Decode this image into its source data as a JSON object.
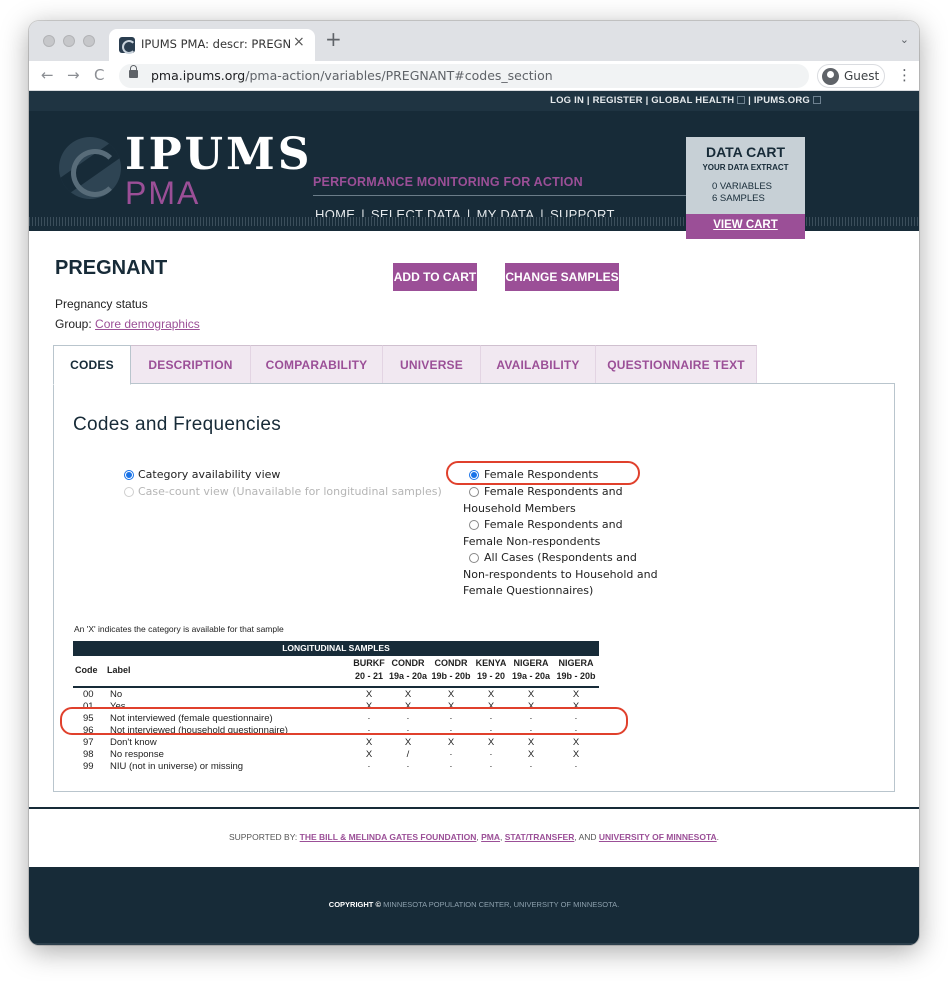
{
  "browser": {
    "tab_title": "IPUMS PMA: descr: PREGNANT",
    "tab_close": "×",
    "new_tab": "+",
    "tab_menu": "⌄",
    "url_host": "pma.ipums.org",
    "url_path": "/pma-action/variables/PREGNANT#codes_section",
    "guest_label": "Guest",
    "back": "←",
    "forward": "→",
    "reload": "C",
    "menu": "⋮"
  },
  "site": {
    "top_links": [
      "LOG IN",
      "REGISTER",
      "GLOBAL HEALTH",
      "IPUMS.ORG"
    ],
    "logo_main": "IPUMS",
    "logo_sub": "PMA",
    "tagline": "PERFORMANCE MONITORING FOR ACTION",
    "nav": [
      "HOME",
      "SELECT DATA",
      "MY DATA",
      "SUPPORT"
    ]
  },
  "cart": {
    "title": "DATA CART",
    "subtitle": "YOUR DATA EXTRACT",
    "variables": "0  VARIABLES",
    "samples": "6  SAMPLES",
    "view_cart": "VIEW CART"
  },
  "variable": {
    "name": "PREGNANT",
    "add_to_cart": "ADD TO CART",
    "change_samples": "CHANGE SAMPLES",
    "description": "Pregnancy status",
    "group_label": "Group: ",
    "group_link": "Core demographics"
  },
  "tabs": [
    "CODES",
    "DESCRIPTION",
    "COMPARABILITY",
    "UNIVERSE",
    "AVAILABILITY",
    "QUESTIONNAIRE TEXT"
  ],
  "codes": {
    "title": "Codes and Frequencies",
    "view_options": [
      {
        "label": "Category availability view",
        "checked": true,
        "disabled": false
      },
      {
        "label": "Case-count view (Unavailable for longitudinal samples)",
        "checked": false,
        "disabled": true
      }
    ],
    "universe_options": [
      {
        "label": "Female Respondents",
        "checked": true
      },
      {
        "label": "Female Respondents and Household Members",
        "checked": false
      },
      {
        "label": "Female Respondents and Female Non-respondents",
        "checked": false
      },
      {
        "label": "All Cases (Respondents and Non-respondents to Household and Female Questionnaires)",
        "checked": false
      }
    ],
    "note": "An 'X' indicates the category is available for that sample",
    "table_header": "LONGITUDINAL SAMPLES",
    "col_code": "Code",
    "col_label": "Label",
    "samples": [
      {
        "top": "BURKF",
        "bottom": "20 - 21"
      },
      {
        "top": "CONDR",
        "bottom": "19a - 20a"
      },
      {
        "top": "CONDR",
        "bottom": "19b - 20b"
      },
      {
        "top": "KENYA",
        "bottom": "19 - 20"
      },
      {
        "top": "NIGERA",
        "bottom": "19a - 20a"
      },
      {
        "top": "NIGERA",
        "bottom": "19b - 20b"
      }
    ],
    "rows": [
      {
        "code": "00",
        "label": "No",
        "vals": [
          "X",
          "X",
          "X",
          "X",
          "X",
          "X"
        ]
      },
      {
        "code": "01",
        "label": "Yes",
        "vals": [
          "X",
          "X",
          "X",
          "X",
          "X",
          "X"
        ]
      },
      {
        "code": "95",
        "label": "Not interviewed (female questionnaire)",
        "vals": [
          "·",
          "·",
          "·",
          "·",
          "·",
          "·"
        ]
      },
      {
        "code": "96",
        "label": "Not interviewed (household questionnaire)",
        "vals": [
          "·",
          "·",
          "·",
          "·",
          "·",
          "·"
        ]
      },
      {
        "code": "97",
        "label": "Don't know",
        "vals": [
          "X",
          "X",
          "X",
          "X",
          "X",
          "X"
        ]
      },
      {
        "code": "98",
        "label": "No response",
        "vals": [
          "X",
          "/",
          "·",
          "·",
          "X",
          "X"
        ]
      },
      {
        "code": "99",
        "label": "NIU (not in universe) or missing",
        "vals": [
          "·",
          "·",
          "·",
          "·",
          "·",
          "·"
        ]
      }
    ]
  },
  "footer": {
    "supported_prefix": "SUPPORTED BY: ",
    "supporter_1": "THE BILL & MELINDA GATES FOUNDATION",
    "sep_1": ", ",
    "supporter_2": "PMA",
    "sep_2": ", ",
    "supporter_3": "STAT/TRANSFER",
    "sep_3": ", AND ",
    "supporter_4": "UNIVERSITY OF MINNESOTA",
    "supported_suffix": ".",
    "copyright_label": "COPYRIGHT ©",
    "copyright_text": " MINNESOTA POPULATION CENTER, UNIVERSITY OF MINNESOTA."
  },
  "colors": {
    "navy": "#172b38",
    "purple": "#9b4f97",
    "annotation": "#e0402c"
  }
}
